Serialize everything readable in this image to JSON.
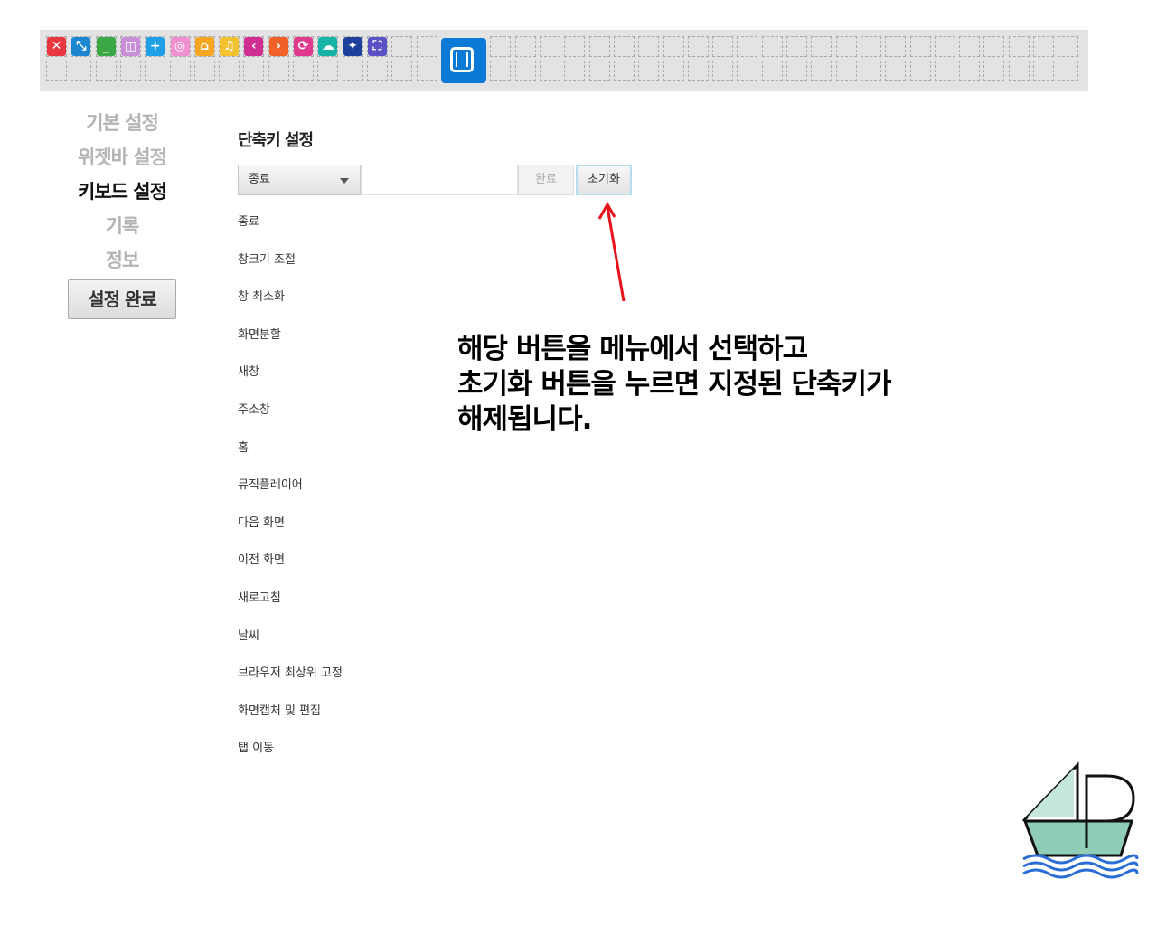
{
  "widget_bar": {
    "icons": [
      {
        "name": "close-icon",
        "glyph": "✕",
        "color": "#e8373e"
      },
      {
        "name": "resize-icon",
        "glyph": "⤡",
        "color": "#1c86d1"
      },
      {
        "name": "minimize-icon",
        "glyph": "_",
        "color": "#3aa845"
      },
      {
        "name": "split-screen-icon",
        "glyph": "◫",
        "color": "#c88fd6"
      },
      {
        "name": "new-window-icon",
        "glyph": "+",
        "color": "#1fa0e6"
      },
      {
        "name": "address-bar-icon",
        "glyph": "◎",
        "color": "#ef8fcf"
      },
      {
        "name": "home-icon",
        "glyph": "⌂",
        "color": "#f6a623"
      },
      {
        "name": "music-player-icon",
        "glyph": "♫",
        "color": "#f2c230"
      },
      {
        "name": "back-icon",
        "glyph": "‹",
        "color": "#cf2d8f"
      },
      {
        "name": "forward-icon",
        "glyph": "›",
        "color": "#f0612a"
      },
      {
        "name": "refresh-icon",
        "glyph": "⟳",
        "color": "#e03a8e"
      },
      {
        "name": "weather-icon",
        "glyph": "☁",
        "color": "#16b3a6"
      },
      {
        "name": "pin-on-top-icon",
        "glyph": "✦",
        "color": "#1e3f9a"
      },
      {
        "name": "capture-icon",
        "glyph": "⛶",
        "color": "#5a52c4"
      }
    ]
  },
  "nav": {
    "basic": "기본 설정",
    "widgetbar": "위젯바 설정",
    "keyboard": "키보드 설정",
    "history": "기록",
    "info": "정보",
    "done": "설정 완료"
  },
  "main": {
    "title": "단축키 설정",
    "select_value": "종료",
    "complete_label": "완료",
    "reset_label": "초기화",
    "shortcuts": [
      "종료",
      "창크기 조절",
      "창 최소화",
      "화면분할",
      "새창",
      "주소창",
      "홈",
      "뮤직플레이어",
      "다음 화면",
      "이전 화면",
      "새로고침",
      "날씨",
      "브라우저 최상위 고정",
      "화면캡처 및 편집",
      "탭 이동"
    ]
  },
  "annotation": {
    "line1": "해당 버튼을 메뉴에서 선택하고",
    "line2": "초기화 버튼을 누르면 지정된 단축키가",
    "line3": "해제됩니다."
  },
  "colors": {
    "accent": "#0a7ad6",
    "arrow": "#e8121b"
  }
}
